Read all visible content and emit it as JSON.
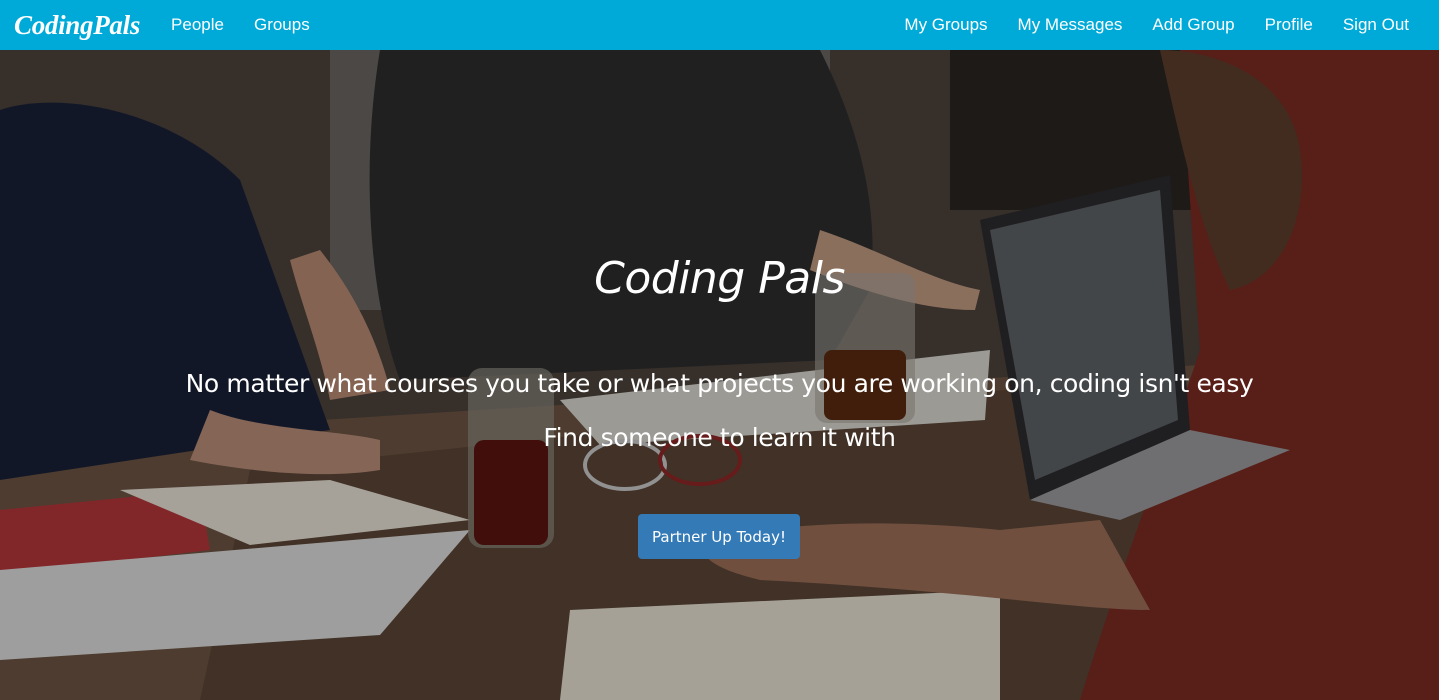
{
  "navbar": {
    "brand": "CodingPals",
    "left_links": [
      "People",
      "Groups"
    ],
    "right_links": [
      "My Groups",
      "My Messages",
      "Add Group",
      "Profile",
      "Sign Out"
    ],
    "color": "#00aad8"
  },
  "hero": {
    "title": "Coding Pals",
    "line1": "No matter what courses you take or what projects you are working on, coding isn't easy",
    "line2": "Find someone to learn it with",
    "cta_label": "Partner Up Today!",
    "cta_color": "#337ab7"
  }
}
